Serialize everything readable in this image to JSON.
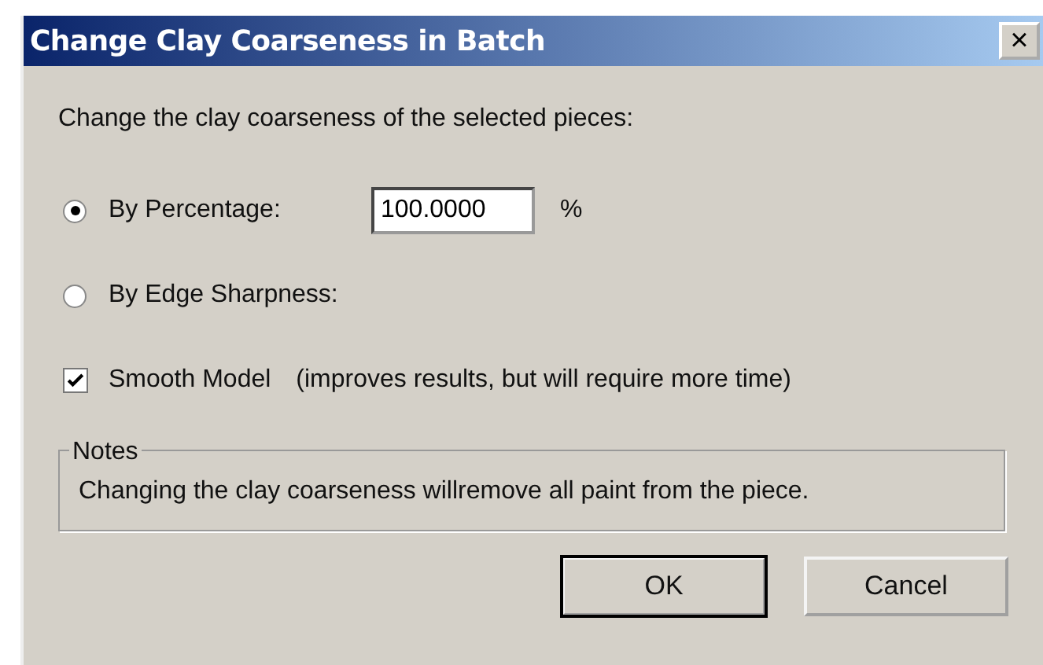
{
  "window": {
    "title": "Change Clay Coarseness in Batch",
    "close_label": "×"
  },
  "intro": "Change the clay coarseness of the selected pieces:",
  "options": [
    {
      "kind": "radio",
      "label": "By Percentage:",
      "selected": true,
      "value": "100.0000",
      "unit": "%"
    },
    {
      "kind": "radio",
      "label": "By Edge Sharpness:",
      "selected": false
    }
  ],
  "smooth": {
    "label": "Smooth Model",
    "hint": "(improves results, but will require more time)",
    "checked": true
  },
  "notes": {
    "title": "Notes",
    "text": "Changing the clay coarseness willremove all paint from the piece."
  },
  "buttons": [
    {
      "label": "OK",
      "default": true
    },
    {
      "label": "Cancel",
      "default": false
    }
  ]
}
